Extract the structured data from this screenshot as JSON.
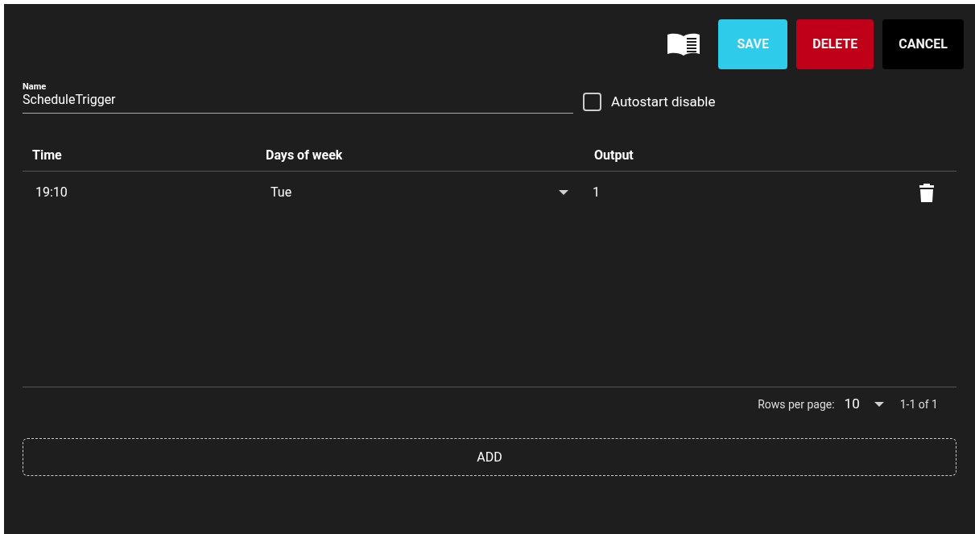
{
  "toolbar": {
    "buttons": [
      {
        "label": "SAVE",
        "kind": "save"
      },
      {
        "label": "DELETE",
        "kind": "delete"
      },
      {
        "label": "CANCEL",
        "kind": "cancel"
      }
    ]
  },
  "name_field": {
    "label": "Name",
    "value": "ScheduleTrigger"
  },
  "autostart_disable": {
    "label": "Autostart disable",
    "checked": false
  },
  "table": {
    "columns": [
      "Time",
      "Days of week",
      "Output"
    ],
    "rows": [
      {
        "time": "19:10",
        "days": "Tue",
        "output": "1"
      }
    ]
  },
  "pagination": {
    "label": "Rows per page:",
    "rows_per_page": "10",
    "range": "1-1 of 1"
  },
  "add_button": {
    "label": "ADD"
  }
}
